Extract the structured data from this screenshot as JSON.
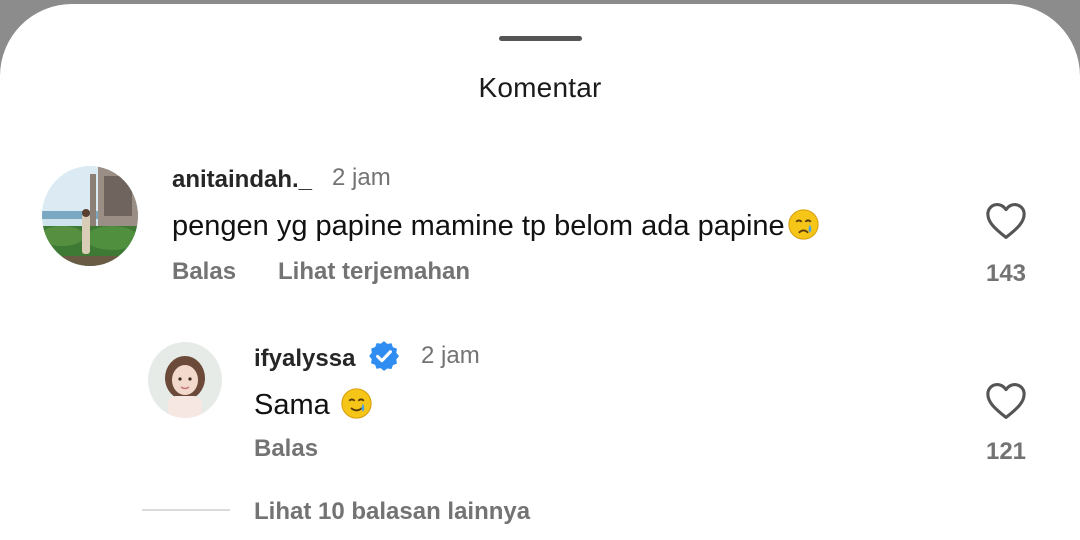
{
  "sheet": {
    "title": "Komentar"
  },
  "comment": {
    "username": "anitaindah._",
    "time": "2 jam",
    "text": "pengen yg papine mamine tp belom ada papine",
    "emoji": "crying-face",
    "reply_label": "Balas",
    "translate_label": "Lihat terjemahan",
    "likes": "143"
  },
  "reply": {
    "username": "ifyalyssa",
    "verified": true,
    "time": "2 jam",
    "text": "Sama",
    "emoji": "smiling-face-with-tear",
    "reply_label": "Balas",
    "likes": "121"
  },
  "more_replies": {
    "label": "Lihat 10 balasan lainnya"
  },
  "colors": {
    "verified": "#2f8cf0",
    "muted": "#737373",
    "emoji": "#f5c518"
  }
}
